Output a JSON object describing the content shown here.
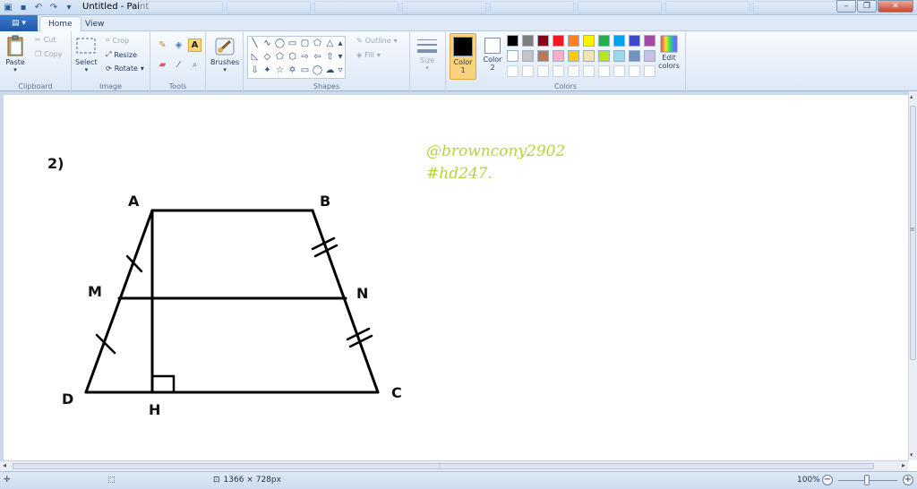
{
  "window": {
    "title": "Untitled - Paint",
    "minimize": "–",
    "restore": "❐",
    "close": "✕"
  },
  "tabs": {
    "file": "▤ ▾",
    "home": "Home",
    "view": "View"
  },
  "ribbon": {
    "clipboard": {
      "label": "Clipboard",
      "paste": "Paste",
      "cut": "Cut",
      "copy": "Copy"
    },
    "image": {
      "label": "Image",
      "select": "Select",
      "crop": "Crop",
      "resize": "Resize",
      "rotate": "Rotate"
    },
    "tools": {
      "label": "Tools"
    },
    "brushes": {
      "label": "Brushes"
    },
    "shapes": {
      "label": "Shapes",
      "outline": "Outline",
      "fill": "Fill"
    },
    "size": {
      "label": "Size"
    },
    "colors": {
      "label": "Colors",
      "color1": "Color\n1",
      "color2": "Color\n2",
      "edit": "Edit\ncolors",
      "color1_value": "#000000",
      "color2_value": "#ffffff",
      "palette_row1": [
        "#000000",
        "#7f7f7f",
        "#880015",
        "#ed1c24",
        "#ff7f27",
        "#fff200",
        "#22b14c",
        "#00a2e8",
        "#3f48cc",
        "#a349a4"
      ],
      "palette_row2": [
        "#ffffff",
        "#c3c3c3",
        "#b97a57",
        "#ffaec9",
        "#ffc90e",
        "#efe4b0",
        "#b5e61d",
        "#99d9ea",
        "#7092be",
        "#c8bfe7"
      ],
      "palette_row3": [
        "#ffffff",
        "#ffffff",
        "#ffffff",
        "#ffffff",
        "#ffffff",
        "#ffffff",
        "#ffffff",
        "#ffffff",
        "#ffffff",
        "#ffffff"
      ]
    }
  },
  "drawing": {
    "problem_number": "2)",
    "points": {
      "A": "A",
      "B": "B",
      "C": "C",
      "D": "D",
      "M": "M",
      "N": "N",
      "H": "H"
    },
    "watermark_line1": "@browncony2902",
    "watermark_line2": "#hd247."
  },
  "status": {
    "dimensions": "1366 × 728px",
    "zoom": "100%"
  }
}
